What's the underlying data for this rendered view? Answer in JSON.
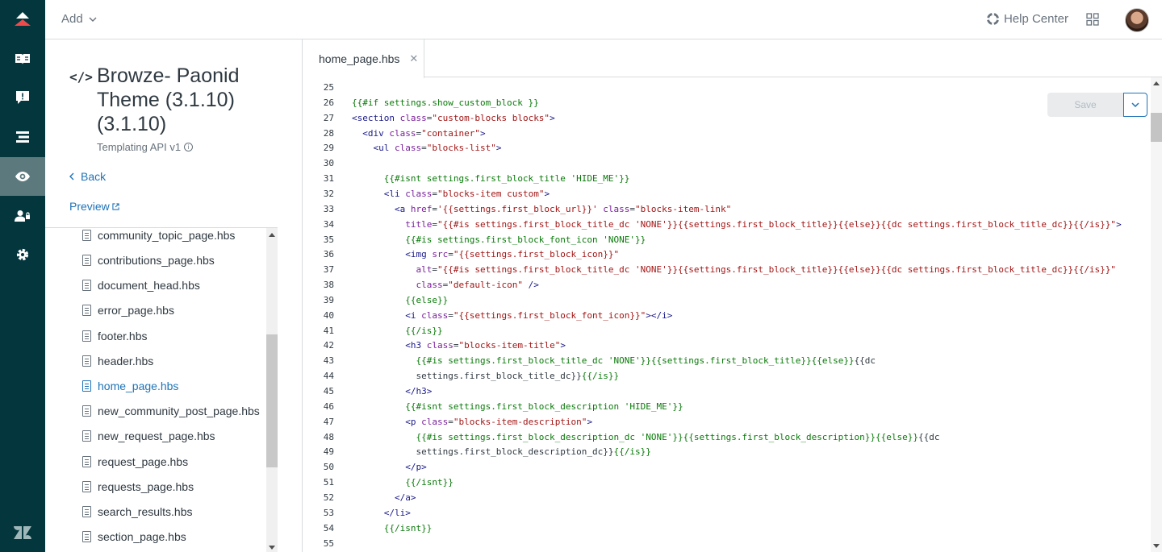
{
  "colors": {
    "nav_bg": "#03363d",
    "nav_active": "#5c7a7e",
    "logo_red": "#f04b4b",
    "link": "#1f73b7"
  },
  "nav": {
    "items": [
      {
        "icon": "zendesk-guide-logo-icon"
      },
      {
        "icon": "knowledge-base-icon"
      },
      {
        "icon": "moderation-icon"
      },
      {
        "icon": "arrange-content-icon"
      },
      {
        "icon": "customize-design-icon"
      },
      {
        "icon": "user-permissions-icon"
      },
      {
        "icon": "settings-gear-icon"
      },
      {
        "icon": "zendesk-products-icon"
      }
    ]
  },
  "topbar": {
    "add_label": "Add",
    "help_label": "Help Center"
  },
  "sidebar": {
    "theme_title": "Browze- Paonid Theme (3.1.10) (3.1.10)",
    "theme_subtitle": "Templating API v1",
    "back_label": "Back",
    "preview_label": "Preview",
    "files": [
      {
        "name": "community_topic_page.hbs"
      },
      {
        "name": "contributions_page.hbs"
      },
      {
        "name": "document_head.hbs"
      },
      {
        "name": "error_page.hbs"
      },
      {
        "name": "footer.hbs"
      },
      {
        "name": "header.hbs"
      },
      {
        "name": "home_page.hbs"
      },
      {
        "name": "new_community_post_page.hbs"
      },
      {
        "name": "new_request_page.hbs"
      },
      {
        "name": "request_page.hbs"
      },
      {
        "name": "requests_page.hbs"
      },
      {
        "name": "search_results.hbs"
      },
      {
        "name": "section_page.hbs"
      }
    ],
    "active_file": "home_page.hbs"
  },
  "editor": {
    "tab_label": "home_page.hbs",
    "save_label": "Save",
    "lines": [
      {
        "n": "25",
        "code": ""
      },
      {
        "n": "26",
        "code": "{{#if settings.show_custom_block }}"
      },
      {
        "n": "27",
        "code": "<section class=\"custom-blocks blocks\">"
      },
      {
        "n": "28",
        "code": "  <div class=\"container\">"
      },
      {
        "n": "29",
        "code": "    <ul class=\"blocks-list\">"
      },
      {
        "n": "30",
        "code": ""
      },
      {
        "n": "31",
        "code": "      {{#isnt settings.first_block_title 'HIDE_ME'}}"
      },
      {
        "n": "32",
        "code": "      <li class=\"blocks-item custom\">"
      },
      {
        "n": "33",
        "code": "        <a href='{{settings.first_block_url}}' class=\"blocks-item-link\""
      },
      {
        "n": "34",
        "code": "          title=\"{{#is settings.first_block_title_dc 'NONE'}}{{settings.first_block_title}}{{else}}{{dc settings.first_block_title_dc}}{{/is}}\">"
      },
      {
        "n": "35",
        "code": "          {{#is settings.first_block_font_icon 'NONE'}}"
      },
      {
        "n": "36",
        "code": "          <img src=\"{{settings.first_block_icon}}\""
      },
      {
        "n": "37",
        "code": "            alt=\"{{#is settings.first_block_title_dc 'NONE'}}{{settings.first_block_title}}{{else}}{{dc settings.first_block_title_dc}}{{/is}}\""
      },
      {
        "n": "38",
        "code": "            class=\"default-icon\" />"
      },
      {
        "n": "39",
        "code": "          {{else}}"
      },
      {
        "n": "40",
        "code": "          <i class=\"{{settings.first_block_font_icon}}\"></i>"
      },
      {
        "n": "41",
        "code": "          {{/is}}"
      },
      {
        "n": "42",
        "code": "          <h3 class=\"blocks-item-title\">"
      },
      {
        "n": "43",
        "code": "            {{#is settings.first_block_title_dc 'NONE'}}{{settings.first_block_title}}{{else}}{{dc"
      },
      {
        "n": "44",
        "code": "            settings.first_block_title_dc}}{{/is}}"
      },
      {
        "n": "45",
        "code": "          </h3>"
      },
      {
        "n": "46",
        "code": "          {{#isnt settings.first_block_description 'HIDE_ME'}}"
      },
      {
        "n": "47",
        "code": "          <p class=\"blocks-item-description\">"
      },
      {
        "n": "48",
        "code": "            {{#is settings.first_block_description_dc 'NONE'}}{{settings.first_block_description}}{{else}}{{dc"
      },
      {
        "n": "49",
        "code": "            settings.first_block_description_dc}}{{/is}}"
      },
      {
        "n": "50",
        "code": "          </p>"
      },
      {
        "n": "51",
        "code": "          {{/isnt}}"
      },
      {
        "n": "52",
        "code": "        </a>"
      },
      {
        "n": "53",
        "code": "      </li>"
      },
      {
        "n": "54",
        "code": "      {{/isnt}}"
      },
      {
        "n": "55",
        "code": ""
      }
    ]
  }
}
